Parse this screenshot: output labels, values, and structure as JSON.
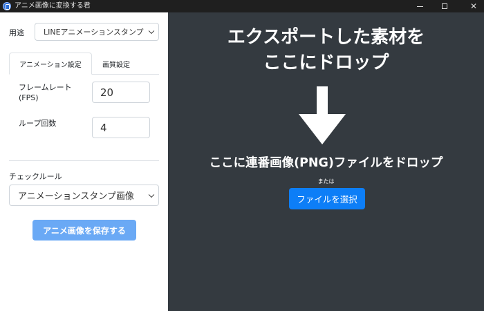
{
  "window": {
    "title": "アニメ画像に変換する君"
  },
  "left_panel": {
    "usage": {
      "label": "用途",
      "selected": "LINEアニメーションスタンプ"
    },
    "tabs": [
      {
        "label": "アニメーション設定",
        "active": true
      },
      {
        "label": "画質設定",
        "active": false
      }
    ],
    "fields": {
      "fps_label_line1": "フレームレート",
      "fps_label_line2": "(FPS)",
      "fps_value": "20",
      "loop_label": "ループ回数",
      "loop_value": "4"
    },
    "check_rule": {
      "label": "チェックルール",
      "selected": "アニメーションスタンプ画像"
    },
    "save_button": "アニメ画像を保存する"
  },
  "drop_zone": {
    "headline_line1": "エクスポートした素材を",
    "headline_line2": "ここにドロップ",
    "arrow_icon": "arrow-down-icon",
    "instruction": "ここに連番画像(PNG)ファイルをドロップ",
    "or_text": "または",
    "select_button": "ファイルを選択"
  },
  "colors": {
    "drop_background": "#343a40",
    "primary": "#0d7ef7",
    "primary_light": "#6aa9f5",
    "titlebar": "#1f1f1f"
  }
}
